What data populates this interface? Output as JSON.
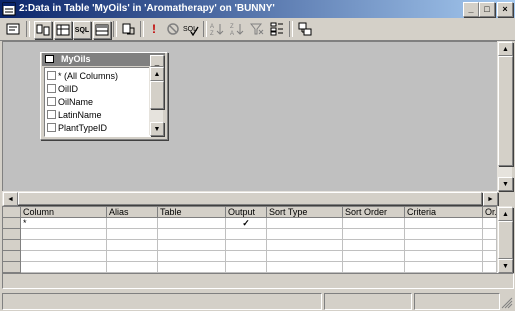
{
  "window": {
    "title": "2:Data in Table 'MyOils' in 'Aromatherapy' on 'BUNNY'",
    "minimize_glyph": "_",
    "maximize_glyph": "□",
    "close_glyph": "×"
  },
  "toolbar": {
    "sql_label": "SQL",
    "run_glyph": "!"
  },
  "table_window": {
    "title": "MyOils",
    "minimize_glyph": "_",
    "columns": [
      "* (All Columns)",
      "OilID",
      "OilName",
      "LatinName",
      "PlantTypeID"
    ]
  },
  "scroll_glyphs": {
    "up": "▲",
    "down": "▼",
    "left": "◄",
    "right": "►"
  },
  "grid": {
    "headers": [
      "Column",
      "Alias",
      "Table",
      "Output",
      "Sort Type",
      "Sort Order",
      "Criteria",
      "Or..."
    ],
    "rows": [
      {
        "column": "*",
        "alias": "",
        "table": "",
        "output": "✓",
        "sort_type": "",
        "sort_order": "",
        "criteria": "",
        "or": ""
      }
    ]
  },
  "colors": {
    "title_start": "#0a246a",
    "title_end": "#a6caf0",
    "face": "#d4d0c8",
    "diagram_bg": "#c0c0c0",
    "inactive_title": "#808080"
  }
}
